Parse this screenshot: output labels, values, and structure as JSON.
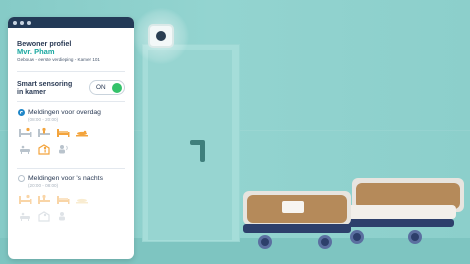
{
  "profile": {
    "heading": "Bewoner profiel",
    "resident_name": "Mvr. Pham",
    "location": "Gebouw - eerste verdieping - Kamer 101"
  },
  "smart_sensoring": {
    "label_line1": "Smart sensoring",
    "label_line2": "in kamer",
    "toggle_label": "ON"
  },
  "day_notifications": {
    "title": "Meldingen voor overdag",
    "time": "(08:00 - 20:00)"
  },
  "night_notifications": {
    "title": "Meldingen voor 's nachts",
    "time": "(20:00 - 08:00)"
  },
  "colors": {
    "accent": "#18a7a0",
    "orange": "#f3a43d",
    "toggle_on": "#34c26a",
    "panel_header": "#233a57"
  },
  "icons": [
    "bed-out-icon",
    "bed-sit-icon",
    "bed-lie-icon",
    "floor-fall-icon",
    "bath-icon",
    "wandering-icon",
    "presence-icon"
  ]
}
